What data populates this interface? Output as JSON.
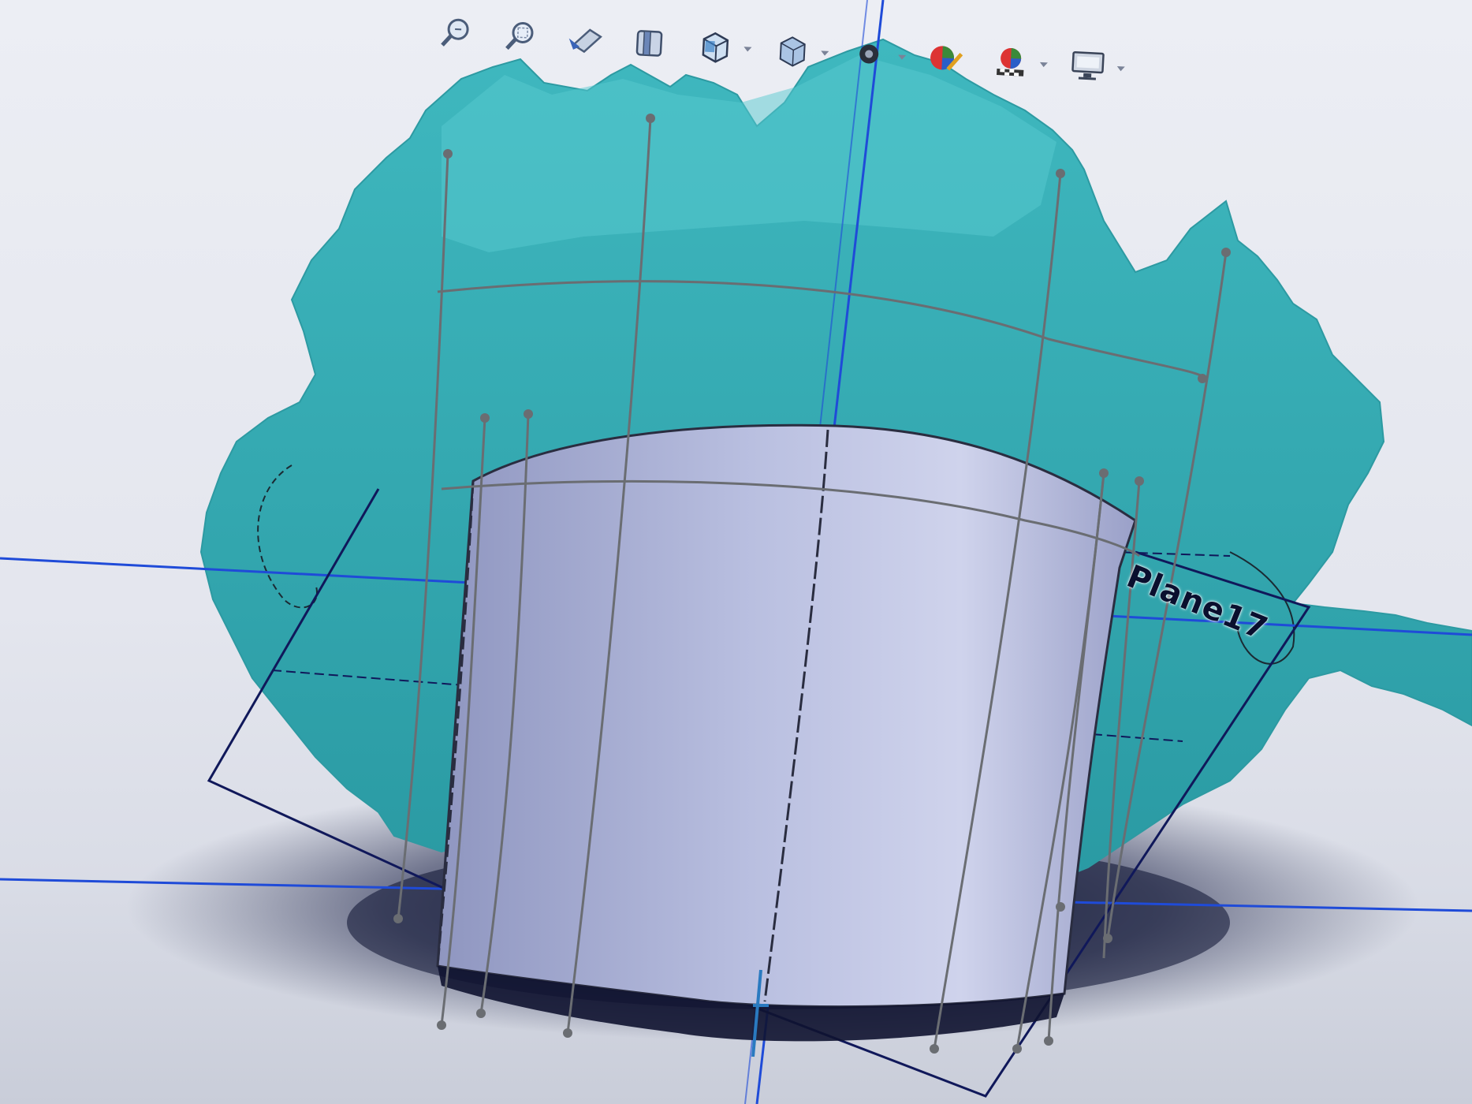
{
  "app": {
    "toolbar": {
      "items": [
        {
          "icon": "zoom-to-fit-icon",
          "has_dropdown": false
        },
        {
          "icon": "zoom-to-area-icon",
          "has_dropdown": false
        },
        {
          "icon": "previous-view-icon",
          "has_dropdown": false
        },
        {
          "icon": "section-view-icon",
          "has_dropdown": false
        },
        {
          "icon": "view-orientation-icon",
          "has_dropdown": true
        },
        {
          "icon": "display-style-icon",
          "has_dropdown": true
        },
        {
          "icon": "hide-show-items-icon",
          "has_dropdown": true
        },
        {
          "icon": "edit-appearance-icon",
          "has_dropdown": false
        },
        {
          "icon": "apply-scene-icon",
          "has_dropdown": true
        },
        {
          "icon": "view-settings-icon",
          "has_dropdown": true
        }
      ]
    }
  },
  "viewport": {
    "plane_label": "Plane17",
    "colors": {
      "scan_mesh": "#3fb8bf",
      "surface_body": "#b9bfe0",
      "plane_edge": "#1f4bd8",
      "sketch_curve": "#6a6d72",
      "background": "#e7e9ef"
    }
  }
}
